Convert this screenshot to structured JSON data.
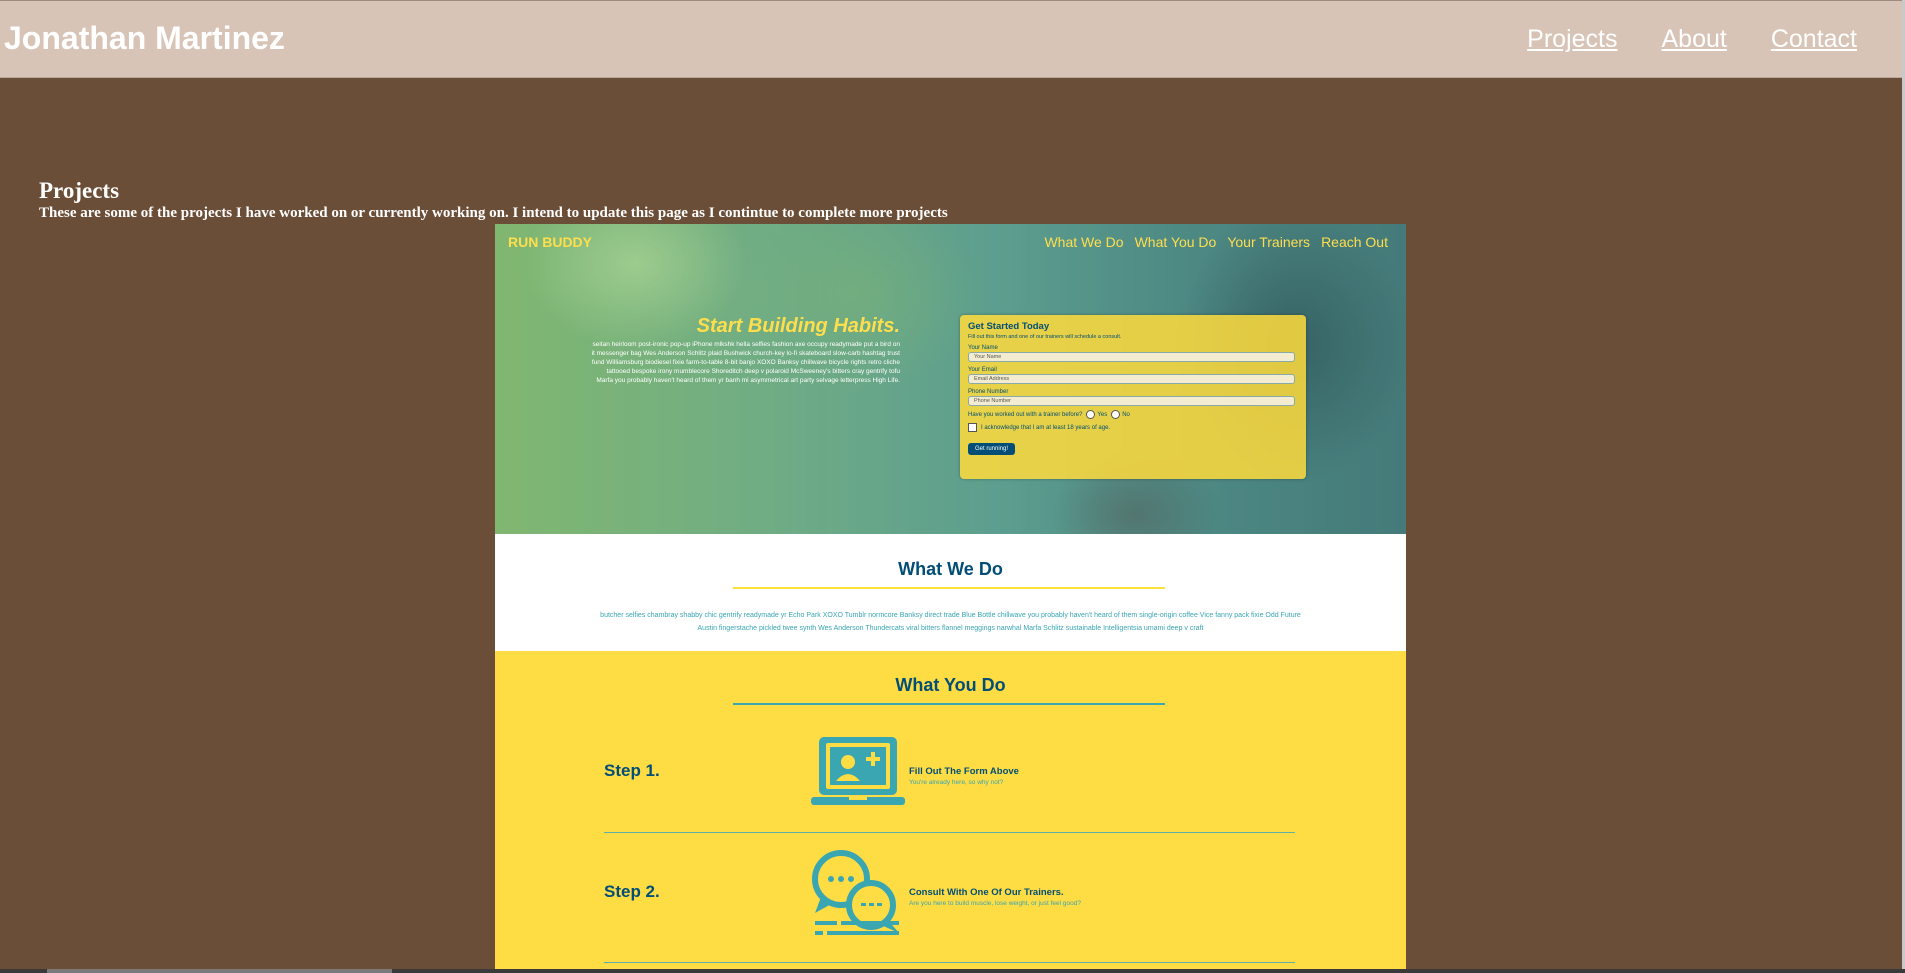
{
  "header": {
    "site_name": "Jonathan Martinez",
    "nav": [
      "Projects",
      "About",
      "Contact"
    ]
  },
  "projects": {
    "title": "Projects",
    "description": "These are some of the projects I have worked on or currently working on. I intend to update this page as I contintue to complete more projects"
  },
  "run_buddy": {
    "brand": "RUN BUDDY",
    "nav": [
      "What We Do",
      "What You Do",
      "Your Trainers",
      "Reach Out"
    ],
    "headline": "Start Building Habits.",
    "hero_text": "seitan heirloom post-ironic pop-up iPhone mlkshk hella selfies fashion axe occupy readymade put a bird on it messenger bag Wes Anderson Schlitz plaid Bushwick church-key lo-fi skateboard slow-carb hashtag trust fund Williamsburg biodiesel fixie farm-to-table 8-bit banjo XOXO Banksy chillwave bicycle rights retro cliche tattooed bespoke irony mumblecore Shoreditch deep v polaroid McSweeney's bitters cray gentrify tofu Marfa you probably haven't heard of them yr banh mi asymmetrical art party selvage letterpress High Life.",
    "form": {
      "title": "Get Started Today",
      "subtitle": "Fill out this form and one of our trainers will schedule a consult.",
      "name_label": "Your Name",
      "name_placeholder": "Your Name",
      "email_label": "Your Email",
      "email_placeholder": "Email Address",
      "phone_label": "Phone Number",
      "phone_placeholder": "Phone Number",
      "trainer_question": "Have you worked out with a trainer before?",
      "yes_label": "Yes",
      "no_label": "No",
      "age_ack": "I acknowledge that I am at least 18 years of age.",
      "submit_label": "Get running!"
    },
    "what_we_do": {
      "title": "What We Do",
      "text": "butcher selfies chambray shabby chic gentrify readymade yr Echo Park XOXO Tumblr normcore Banksy direct trade Blue Bottle chillwave you probably haven't heard of them single-origin coffee Vice fanny pack fixie Odd Future Austin fingerstache pickled twee synth Wes Anderson Thundercats viral bitters flannel meggings narwhal Marfa Schlitz sustainable Intelligentsia umami deep v craft"
    },
    "what_you_do": {
      "title": "What You Do",
      "steps": [
        {
          "label": "Step 1.",
          "title": "Fill Out The Form Above",
          "subtitle": "You're already here, so why not?"
        },
        {
          "label": "Step 2.",
          "title": "Consult With One Of Our Trainers.",
          "subtitle": "Are you here to build muscle, lose weight, or just feel good?"
        }
      ]
    },
    "colors": {
      "yellow": "#fedc44",
      "navy": "#024e76",
      "teal": "#39a6b2"
    }
  },
  "colors": {
    "page_background": "#6b4e37",
    "header_background": "#d8c4b6"
  }
}
